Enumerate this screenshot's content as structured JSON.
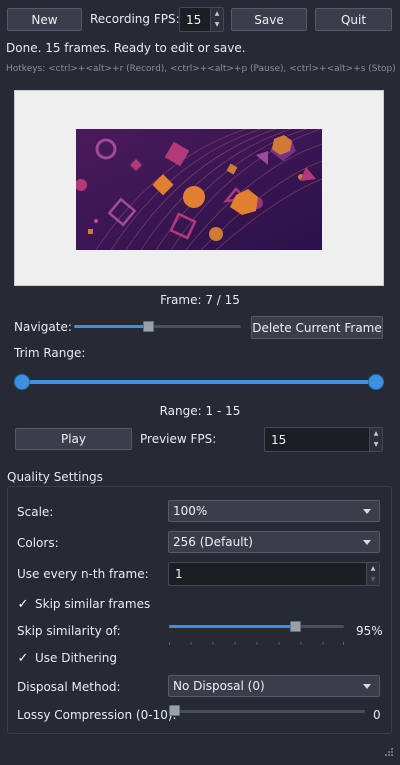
{
  "toolbar": {
    "new_label": "New",
    "fps_label": "Recording FPS:",
    "fps_value": "15",
    "save_label": "Save",
    "quit_label": "Quit"
  },
  "status": {
    "message": "Done. 15 frames. Ready to edit or save.",
    "hotkeys": "Hotkeys: <ctrl>+<alt>+r (Record), <ctrl>+<alt>+p (Pause), <ctrl>+<alt>+s (Stop)"
  },
  "preview": {
    "frame_text": "Frame: 7 / 15"
  },
  "navigate": {
    "label": "Navigate:",
    "position": 0.45,
    "delete_label": "Delete Current Frame"
  },
  "trim": {
    "label": "Trim Range:",
    "range_text": "Range: 1 - 15"
  },
  "playback": {
    "play_label": "Play",
    "fps_label": "Preview FPS:",
    "fps_value": "15"
  },
  "quality": {
    "title": "Quality Settings",
    "scale_label": "Scale:",
    "scale_value": "100%",
    "colors_label": "Colors:",
    "colors_value": "256 (Default)",
    "nth_label": "Use every n-th frame:",
    "nth_value": "1",
    "skip_similar_label": "Skip similar frames",
    "skip_similarity_label": "Skip similarity of:",
    "skip_similarity_value": "95%",
    "dithering_label": "Use Dithering",
    "disposal_label": "Disposal Method:",
    "disposal_value": "No Disposal (0)",
    "lossy_label": "Lossy Compression (0-10):",
    "lossy_value": "0"
  },
  "colors": {
    "accent": "#3d8fe0",
    "background": "#262a35",
    "preview_bg": "#efefef",
    "frame_bg": "#3a1550"
  }
}
